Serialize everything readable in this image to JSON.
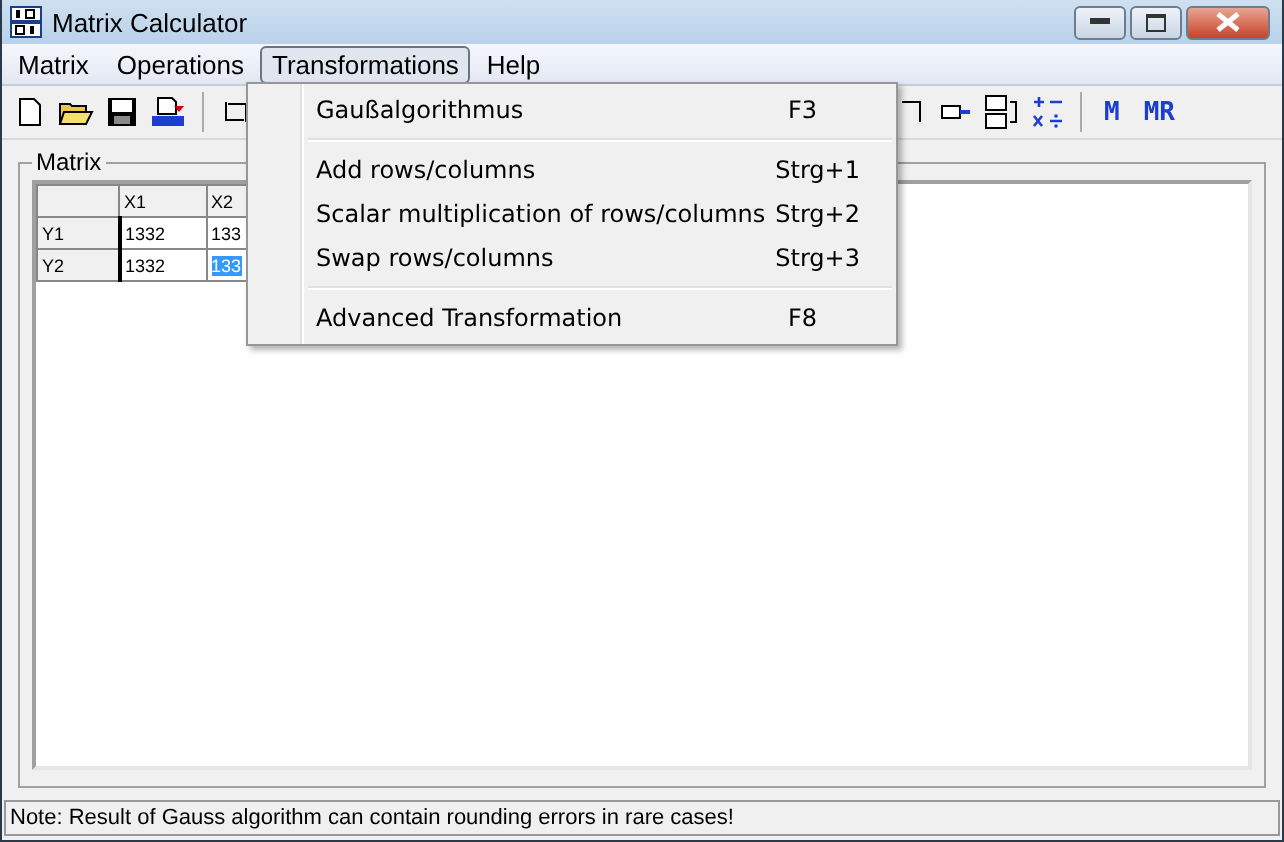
{
  "window": {
    "title": "Matrix Calculator"
  },
  "menu_bar": [
    {
      "label": "Matrix",
      "selected": false
    },
    {
      "label": "Operations",
      "selected": false
    },
    {
      "label": "Transformations",
      "selected": true
    },
    {
      "label": "Help",
      "selected": false
    }
  ],
  "toolbar": {
    "text_buttons": [
      "M",
      "MR"
    ]
  },
  "matrix": {
    "title": "Matrix",
    "columns": [
      "X1",
      "X2"
    ],
    "rows": [
      {
        "header": "Y1",
        "cells": [
          {
            "value": "1332",
            "selected": false
          },
          {
            "value": "133",
            "selected": false
          }
        ]
      },
      {
        "header": "Y2",
        "cells": [
          {
            "value": "1332",
            "selected": false
          },
          {
            "value": "133",
            "selected": true
          }
        ]
      }
    ]
  },
  "dropdown": [
    {
      "kind": "item",
      "label": "Gaußalgorithmus",
      "shortcut": "F3"
    },
    {
      "kind": "separator"
    },
    {
      "kind": "item",
      "label": "Add rows/columns",
      "shortcut": "Strg+1"
    },
    {
      "kind": "item",
      "label": "Scalar multiplication of rows/columns",
      "shortcut": "Strg+2"
    },
    {
      "kind": "item",
      "label": "Swap rows/columns",
      "shortcut": "Strg+3"
    },
    {
      "kind": "separator"
    },
    {
      "kind": "item",
      "label": "Advanced Transformation",
      "shortcut": "F8"
    }
  ],
  "status_bar": "Note: Result of Gauss algorithm can contain rounding errors in rare cases!"
}
